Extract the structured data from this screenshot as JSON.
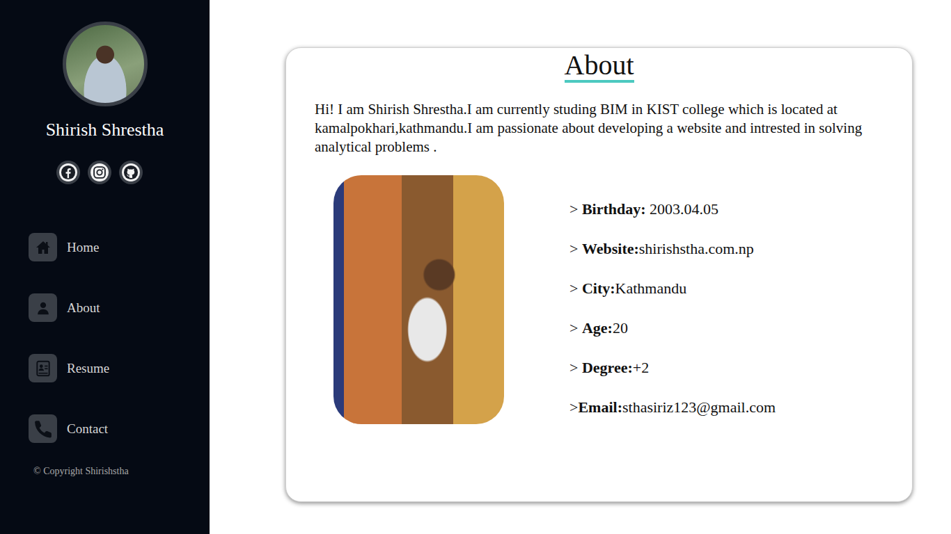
{
  "profile": {
    "name": "Shirish Shrestha"
  },
  "nav": [
    {
      "label": "Home"
    },
    {
      "label": "About"
    },
    {
      "label": "Resume"
    },
    {
      "label": "Contact"
    }
  ],
  "copyright": "© Copyright Shirishstha",
  "about": {
    "title": "About",
    "intro": "Hi! I am Shirish Shrestha.I am currently studing BIM in KIST college which is located at kamalpokhari,kathmandu.I am passionate about developing a website and intrested in solving analytical problems .",
    "details": [
      {
        "prefix": "> ",
        "label": "Birthday:",
        "value": " 2003.04.05"
      },
      {
        "prefix": "> ",
        "label": "Website:",
        "value": "shirishstha.com.np"
      },
      {
        "prefix": "> ",
        "label": "City:",
        "value": "Kathmandu"
      },
      {
        "prefix": "> ",
        "label": "Age:",
        "value": "20"
      },
      {
        "prefix": "> ",
        "label": "Degree:",
        "value": "+2"
      },
      {
        "prefix": ">",
        "label": "Email:",
        "value": "sthasiriz123@gmail.com"
      }
    ]
  }
}
